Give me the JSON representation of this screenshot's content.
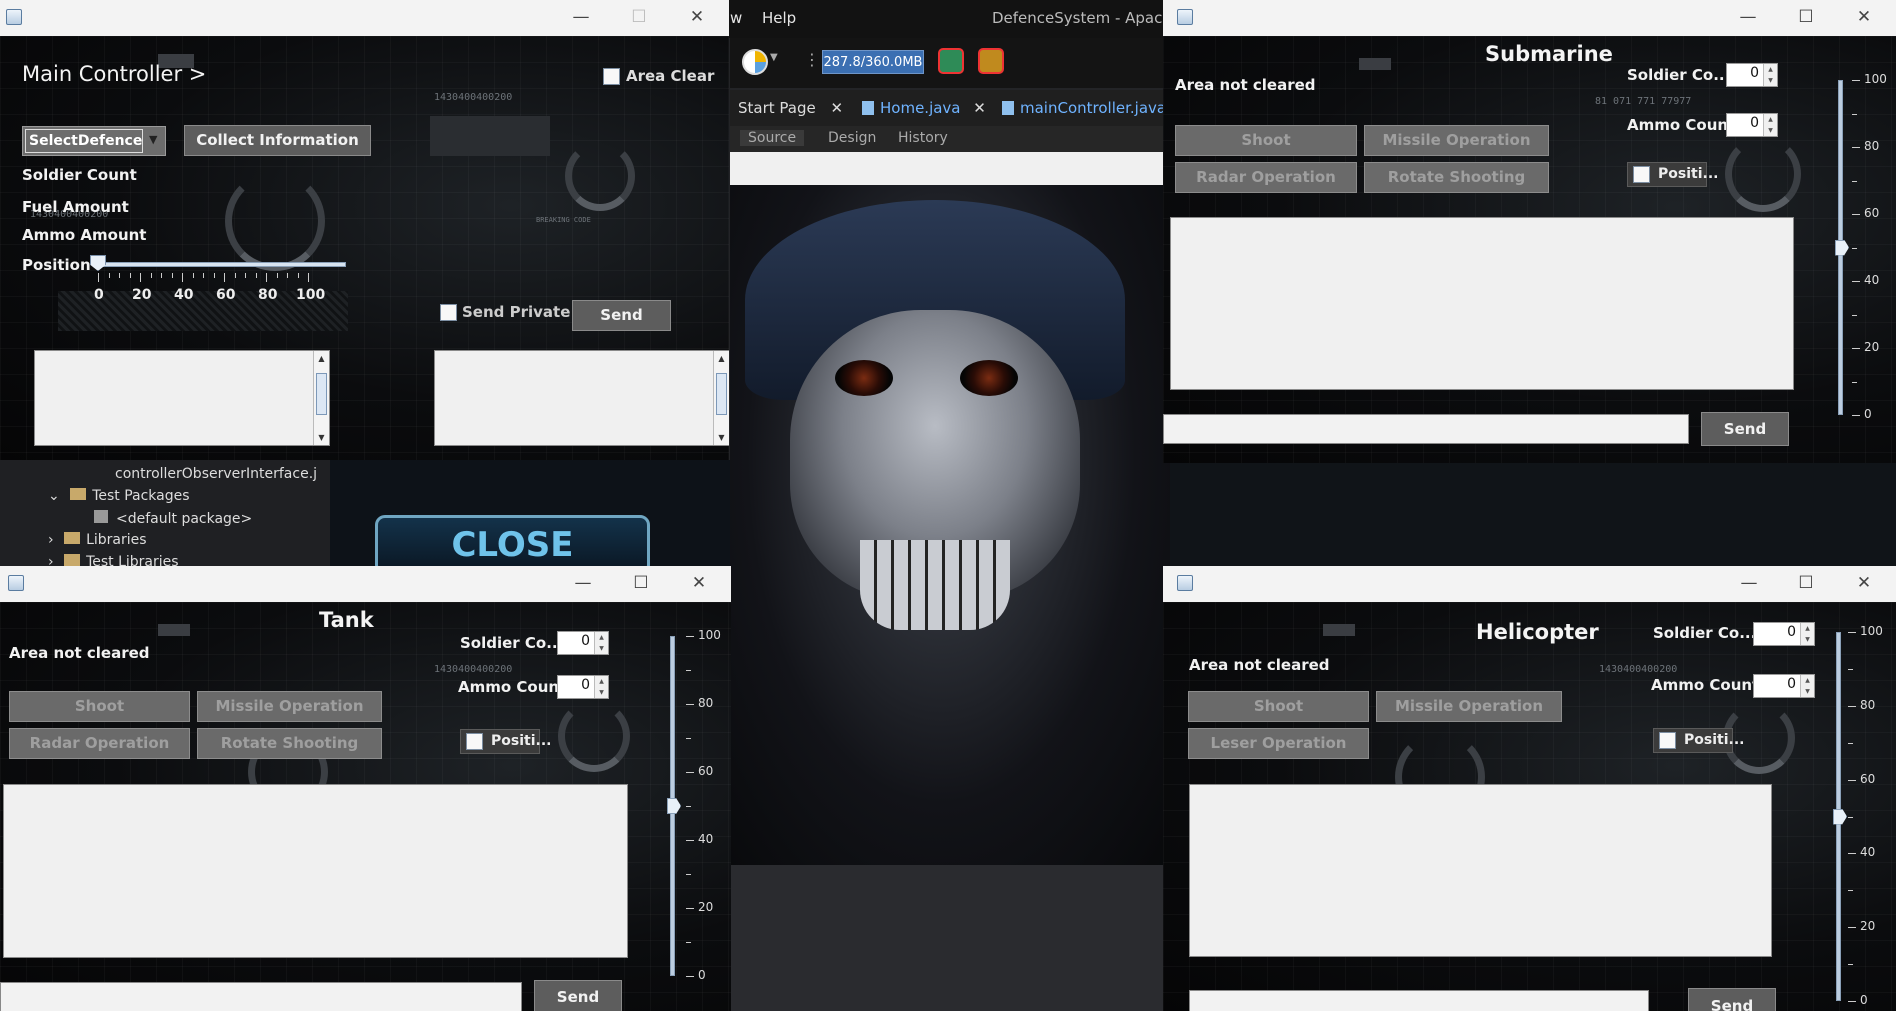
{
  "ide": {
    "menu_view": "w",
    "menu_help": "Help",
    "window_title": "DefenceSystem - Apache",
    "memory": "287.8/360.0MB",
    "tabs": [
      {
        "label": "Start Page"
      },
      {
        "label": "Home.java"
      },
      {
        "label": "mainController.java"
      }
    ],
    "subtabs": [
      "Source",
      "Design",
      "History"
    ],
    "tree": {
      "file": "controllerObserverInterface.j",
      "test_packages": "Test Packages",
      "default_package": "<default package>",
      "libraries": "Libraries",
      "test_libraries": "Test Libraries"
    },
    "close_banner": "CLOSE"
  },
  "main_controller": {
    "title": "Main Controller >",
    "area_clear": "Area Clear",
    "select_defence": "SelectDefence",
    "collect_info": "Collect Information",
    "soldier_count": "Soldier Count",
    "fuel_amount": "Fuel Amount",
    "ammo_amount": "Ammo Amount",
    "position": "Position",
    "position_value": 0,
    "ticks": [
      "0",
      "20",
      "40",
      "60",
      "80",
      "100"
    ],
    "send_private": "Send Private",
    "send": "Send",
    "deco_code": "1430400400200",
    "deco_code2": "1430400400200",
    "deco_breaking": "BREAKING CODE"
  },
  "submarine": {
    "title": "Submarine",
    "status": "Area not cleared",
    "soldier_count_label": "Soldier Co...",
    "soldier_count_value": "0",
    "ammo_count_label": "Ammo Count",
    "ammo_count_value": "0",
    "shoot": "Shoot",
    "missile": "Missile Operation",
    "radar": "Radar Operation",
    "rotate": "Rotate Shooting",
    "position": "Positi...",
    "send": "Send",
    "slider_value": 50,
    "scale": [
      "100",
      "80",
      "60",
      "40",
      "20",
      "0"
    ],
    "deco_code": "81 071 771 77977"
  },
  "tank": {
    "title": "Tank",
    "status": "Area not cleared",
    "soldier_count_label": "Soldier Co...",
    "soldier_count_value": "0",
    "ammo_count_label": "Ammo Count",
    "ammo_count_value": "0",
    "shoot": "Shoot",
    "missile": "Missile Operation",
    "radar": "Radar Operation",
    "rotate": "Rotate Shooting",
    "position": "Positi...",
    "send": "Send",
    "slider_value": 50,
    "scale": [
      "100",
      "80",
      "60",
      "40",
      "20",
      "0"
    ],
    "deco_code": "1430400400200"
  },
  "helicopter": {
    "title": "Helicopter",
    "status": "Area not cleared",
    "soldier_count_label": "Soldier Co...",
    "soldier_count_value": "0",
    "ammo_count_label": "Ammo Count",
    "ammo_count_value": "0",
    "shoot": "Shoot",
    "missile": "Missile Operation",
    "laser": "Leser Operation",
    "position": "Positi...",
    "send": "Send",
    "slider_value": 50,
    "scale": [
      "100",
      "80",
      "60",
      "40",
      "20",
      "0"
    ],
    "deco_code": "1430400400200"
  }
}
